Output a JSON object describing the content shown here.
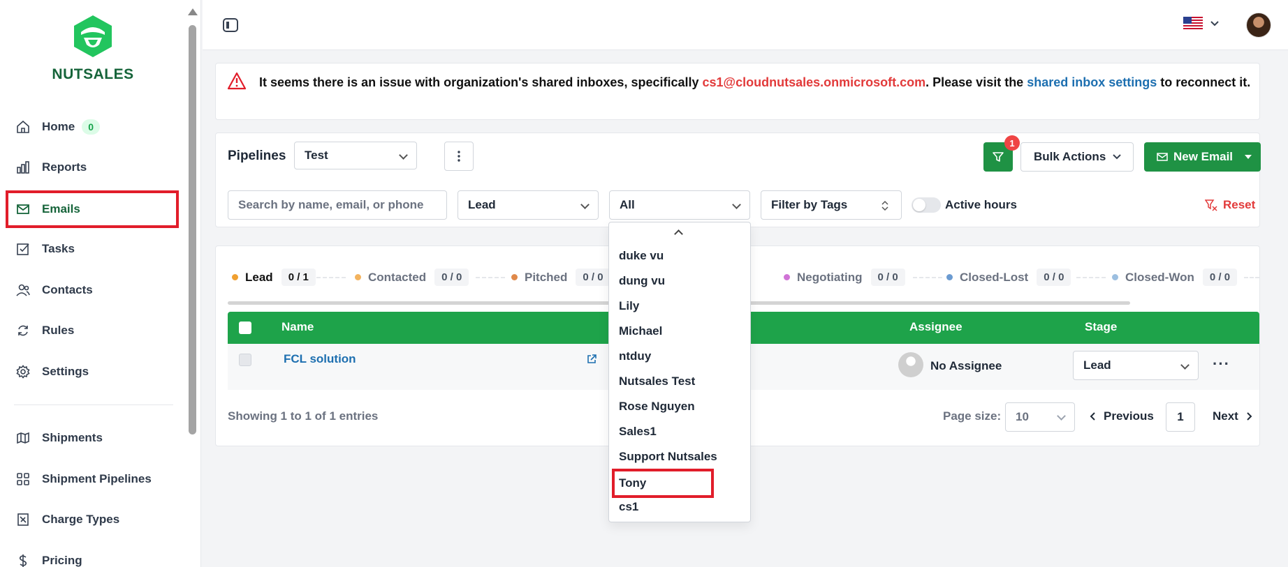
{
  "sidebar": {
    "brand": "NUTSALES",
    "home_badge": "0",
    "items": [
      {
        "label": "Home",
        "icon": "home-icon"
      },
      {
        "label": "Reports",
        "icon": "reports-icon"
      },
      {
        "label": "Emails",
        "icon": "mail-icon"
      },
      {
        "label": "Tasks",
        "icon": "tasks-icon"
      },
      {
        "label": "Contacts",
        "icon": "contacts-icon"
      },
      {
        "label": "Rules",
        "icon": "rules-icon"
      },
      {
        "label": "Settings",
        "icon": "gear-icon"
      },
      {
        "label": "Shipments",
        "icon": "shipments-icon"
      },
      {
        "label": "Shipment Pipelines",
        "icon": "grid-icon"
      },
      {
        "label": "Charge Types",
        "icon": "charge-types-icon"
      },
      {
        "label": "Pricing",
        "icon": "dollar-icon"
      }
    ]
  },
  "topbar": {
    "language_flag": "us-flag-icon"
  },
  "alert": {
    "part1": "It seems there is an issue with organization's shared inboxes, specifically ",
    "email": "cs1@cloudnutsales.onmicrosoft.com",
    "part2": ". Please visit the ",
    "link": "shared inbox settings",
    "part3": " to reconnect it."
  },
  "toolbar": {
    "pipelines_label": "Pipelines",
    "pipeline_value": "Test",
    "filter_count": "1",
    "bulk_actions": "Bulk Actions",
    "new_email": "New Email"
  },
  "filters": {
    "search_placeholder": "Search by name, email, or phone",
    "stage_value": "Lead",
    "assignee_value": "All",
    "tags_placeholder": "Filter by Tags",
    "active_hours": "Active hours",
    "reset": "Reset"
  },
  "stages": [
    {
      "name": "Lead",
      "count": "0 / 1",
      "color": "#f0a030"
    },
    {
      "name": "Contacted",
      "count": "0 / 0",
      "color": "#f3b35e"
    },
    {
      "name": "Pitched",
      "count": "0 / 0",
      "color": "#e0894a"
    },
    {
      "name": "Negotiating",
      "count": "0 / 0",
      "color": "#d073d6"
    },
    {
      "name": "Closed-Lost",
      "count": "0 / 0",
      "color": "#6b9bd1"
    },
    {
      "name": "Closed-Won",
      "count": "0 / 0",
      "color": "#9cbfe0"
    }
  ],
  "table": {
    "headers": {
      "name": "Name",
      "assignee": "Assignee",
      "stage": "Stage"
    },
    "rows": [
      {
        "name": "FCL solution",
        "assignee": "No Assignee",
        "stage": "Lead"
      }
    ]
  },
  "footer": {
    "showing": "Showing 1 to 1 of 1 entries",
    "page_size_label": "Page size:",
    "page_size": "10",
    "previous": "Previous",
    "page": "1",
    "next": "Next"
  },
  "dropdown": {
    "options": [
      "duke vu",
      "dung vu",
      "Lily",
      "Michael",
      "ntduy",
      "Nutsales Test",
      "Rose Nguyen",
      "Sales1",
      "Support Nutsales",
      "Tony",
      "cs1"
    ]
  },
  "colors": {
    "brand_green": "#1f9244",
    "header_green": "#1ea34a",
    "alert_red": "#e23a3a",
    "link_blue": "#1d6fb0"
  }
}
